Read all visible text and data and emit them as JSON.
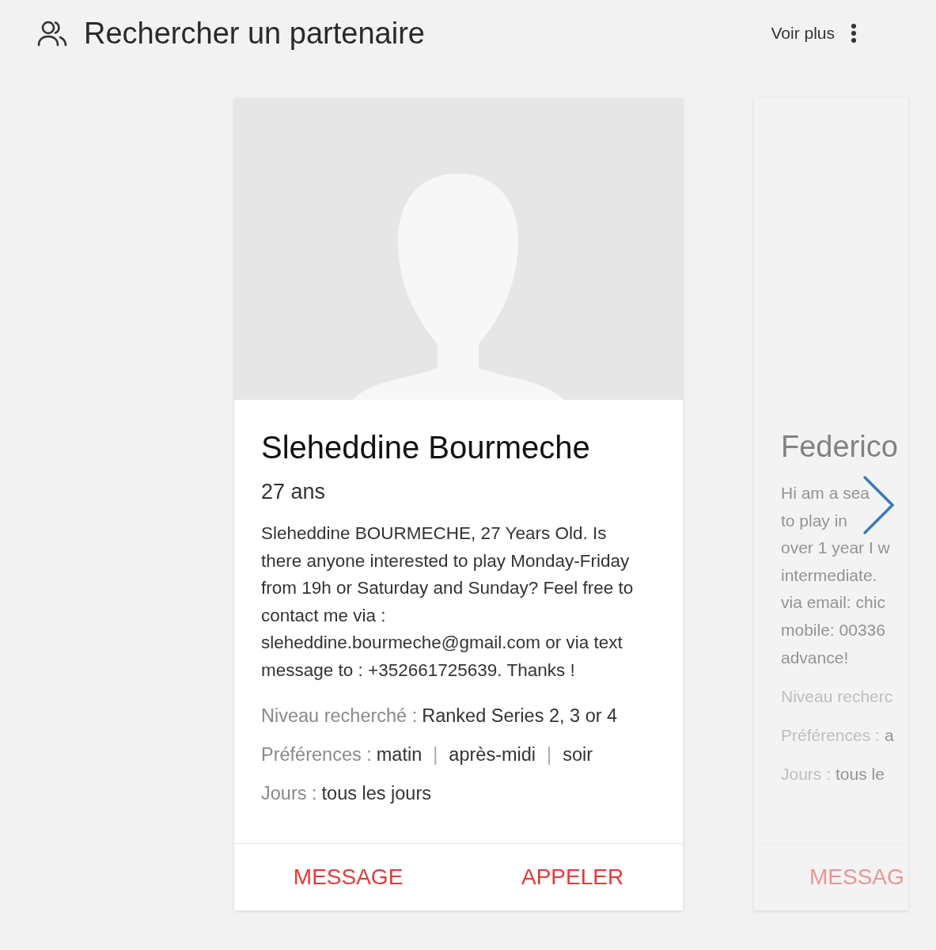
{
  "header": {
    "title": "Rechercher un partenaire",
    "more_label": "Voir plus"
  },
  "cards": [
    {
      "kind": "full",
      "name": "Sleheddine Bourmeche",
      "age": "27 ans",
      "description": "Sleheddine BOURMECHE, 27 Years Old. Is there anyone interested to play Monday-Friday from 19h or Saturday and Sunday? Feel free to contact me via : sleheddine.bourmeche@gmail.com or via text message to : +352661725639. Thanks !",
      "level_label": "Niveau recherché :",
      "level_value": "Ranked Series 2, 3 or 4",
      "prefs_label": "Préférences :",
      "prefs": [
        "matin",
        "après-midi",
        "soir"
      ],
      "separator": "|",
      "days_label": "Jours :",
      "days_value": "tous les jours",
      "buttons": [
        "MESSAGE",
        "APPELER"
      ]
    },
    {
      "kind": "peek",
      "name": "Federico",
      "description_lines": [
        "Hi am a sea",
        "to play in",
        "over 1 year I w",
        "intermediate.",
        "via email: chic",
        "mobile: 00336",
        "advance!"
      ],
      "level_label": "Niveau recherc",
      "prefs_label": "Préférences :",
      "prefs": [
        "a"
      ],
      "days_label": "Jours :",
      "days_value": "tous le",
      "buttons": [
        "MESSAG"
      ]
    }
  ]
}
